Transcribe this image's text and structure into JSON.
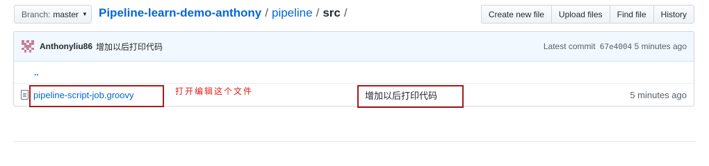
{
  "branch": {
    "prefix": "Branch:",
    "name": "master"
  },
  "breadcrumb": {
    "repo": "Pipeline-learn-demo-anthony",
    "sep1": "/",
    "folder": "pipeline",
    "sep2": "/",
    "current": "src",
    "sep3": "/"
  },
  "actions": {
    "create_new_file": "Create new file",
    "upload_files": "Upload files",
    "find_file": "Find file",
    "history": "History"
  },
  "commit": {
    "author": "Anthonyliu86",
    "message": "增加以后打印代码",
    "latest_label": "Latest commit",
    "sha": "67e4004",
    "age": "5 minutes ago"
  },
  "up_dir": {
    "label": ".."
  },
  "files": [
    {
      "name": "pipeline-script-job.groovy",
      "message": "增加以后打印代码",
      "age": "5 minutes ago"
    }
  ],
  "annotation": {
    "text": "打开编辑这个文件",
    "color": "#e0201c",
    "box_color": "#a31a1a"
  },
  "colors": {
    "link": "#0366d6",
    "commit_bar_bg": "#f1f8ff",
    "avatar": "#c87f96"
  }
}
